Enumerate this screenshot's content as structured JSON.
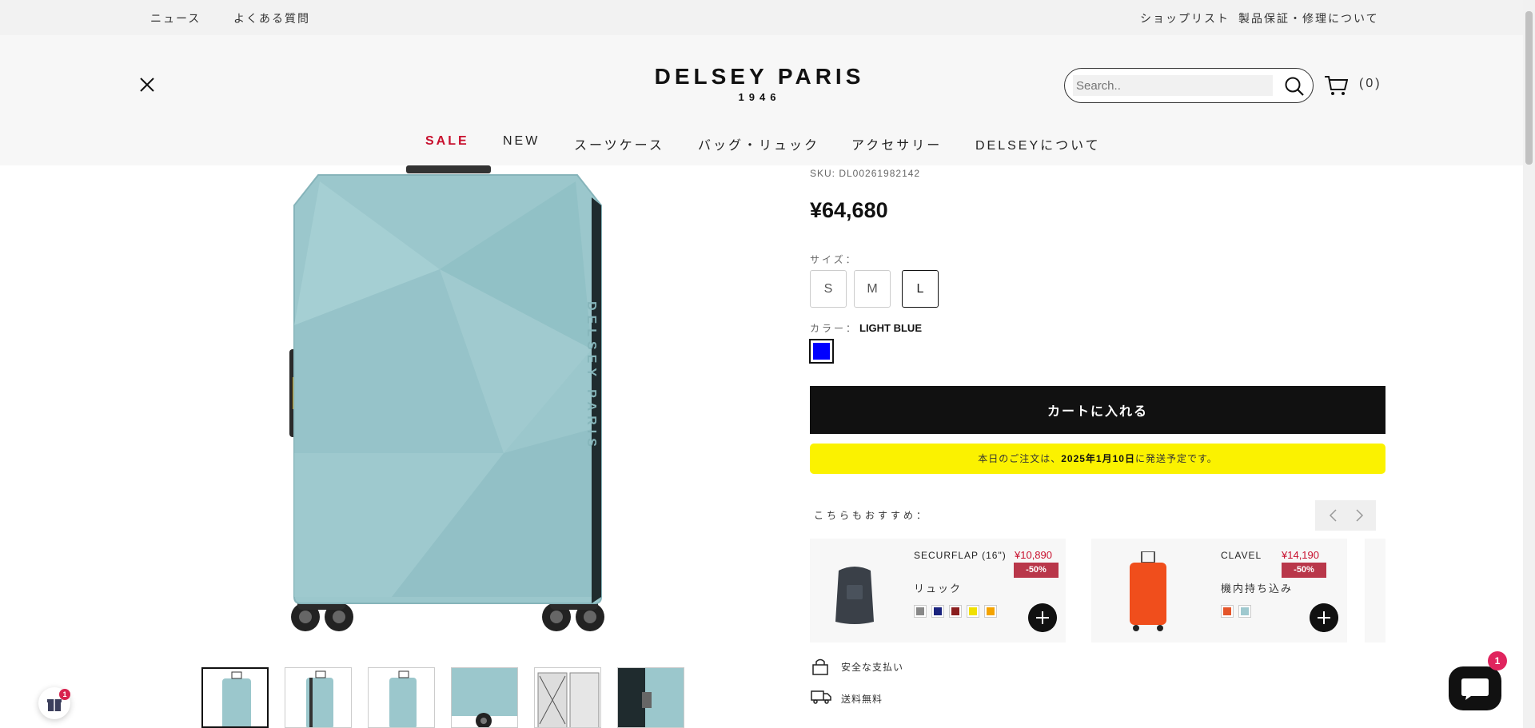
{
  "utility": {
    "left_links": [
      "ニュース",
      "よくある質問"
    ],
    "right_links": [
      "ショップリスト",
      "製品保証・修理について"
    ]
  },
  "header": {
    "logo_main": "DELSEY PARIS",
    "logo_year": "1946",
    "search_placeholder": "Search..",
    "cart_count": "(0)"
  },
  "nav": {
    "items": [
      "SALE",
      "NEW",
      "スーツケース",
      "バッグ・リュック",
      "アクセサリー",
      "DELSEYについて"
    ]
  },
  "product": {
    "sku": "SKU: DL00261982142",
    "price": "¥64,680",
    "size_label": "サイズ：",
    "sizes": [
      "S",
      "M",
      "L"
    ],
    "selected_size": "L",
    "color_label": "カラー：",
    "color_value": "LIGHT BLUE",
    "swatch_color": "#0000ff",
    "body_color": "#9bc7cc",
    "add_to_cart": "カートに入れる",
    "shipping_note_pre": "本日のご注文は、",
    "shipping_note_date": "2025年1月10日",
    "shipping_note_post": "に発送予定です。"
  },
  "recommend": {
    "label": "こちらもおすすめ：",
    "items": [
      {
        "name": "SECURFLAP (16\")",
        "price": "¥10,890",
        "discount": "-50%",
        "category": "リュック",
        "colors": [
          "#888888",
          "#1a237e",
          "#8b1e1e",
          "#f0e000",
          "#f4a300"
        ]
      },
      {
        "name": "CLAVEL",
        "price": "¥14,190",
        "discount": "-50%",
        "category": "機内持ち込み",
        "colors": [
          "#e4552a",
          "#9fc9cf"
        ]
      }
    ]
  },
  "info": {
    "secure_payment": "安全な支払い",
    "free_shipping": "送料無料"
  },
  "floating": {
    "gift_badge": "1",
    "chat_badge": "1"
  }
}
